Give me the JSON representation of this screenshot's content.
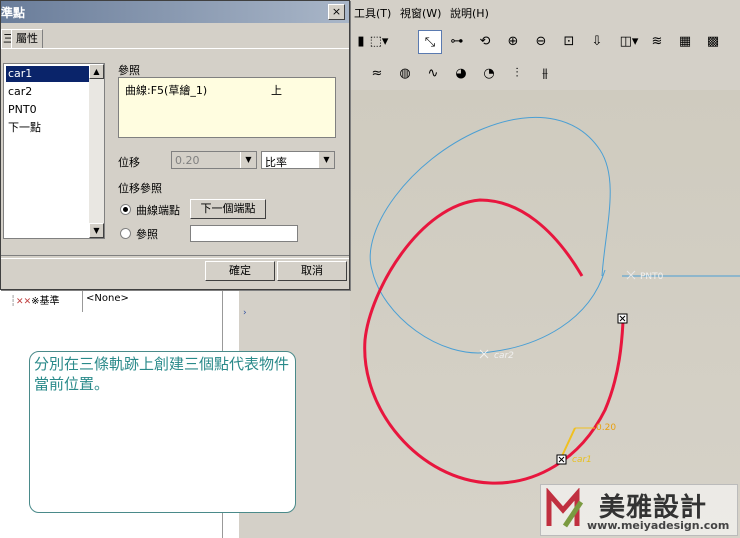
{
  "menu": {
    "tools": "工具(T)",
    "window": "視窗(W)",
    "help": "說明(H)"
  },
  "dialog": {
    "title": "準點",
    "close_label": "×",
    "tab_left": "三",
    "tab_properties": "屬性",
    "list_items": [
      "car1",
      "car2",
      "PNT0",
      "下一點"
    ],
    "selected_item": "car1",
    "reference_label": "參照",
    "reference_curve": "曲線:F5(草繪_1)",
    "reference_side": "上",
    "offset_label": "位移",
    "offset_value": "0.20",
    "offset_type": "比率",
    "offset_ref_label": "位移參照",
    "curve_end_label": "曲線端點",
    "next_end_button": "下一個端點",
    "ref_label": "參照",
    "ok_button": "確定",
    "cancel_button": "取消"
  },
  "tree": {
    "node_label": "※基準",
    "node_value": "<None>"
  },
  "note": {
    "text": "分別在三條軌跡上創建三個點代表物件當前位置。"
  },
  "graphics": {
    "pnt0": "PNT0",
    "car2": "car2",
    "car1": "car1",
    "offset": "0.20"
  },
  "watermark": {
    "brand": "美雅設計",
    "url": "www.meiyadesign.com"
  },
  "colors": {
    "curve_red": "#e8163e",
    "curve_blue": "#4a9fd4",
    "selection": "#0a246a",
    "note_text": "#2a8a8a"
  }
}
